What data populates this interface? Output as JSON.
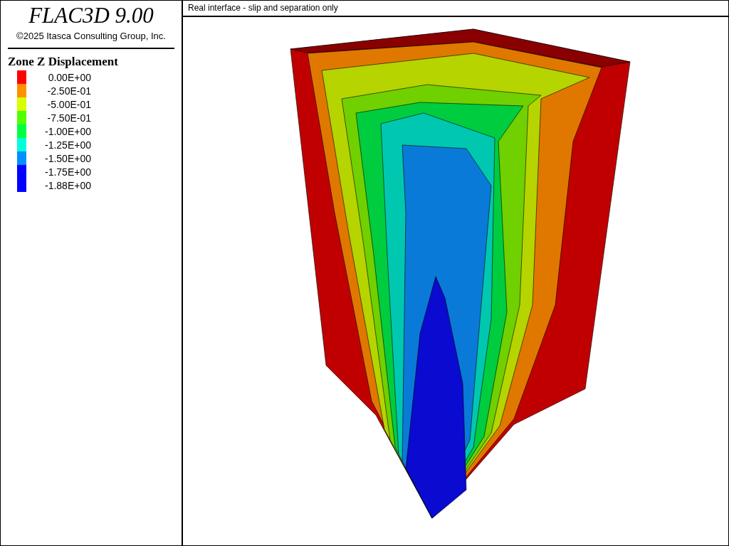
{
  "header": {
    "title": "FLAC3D 9.00",
    "copyright": "©2025 Itasca Consulting Group, Inc."
  },
  "legend": {
    "title": "Zone Z Displacement",
    "items": [
      {
        "value": "0.00E+00",
        "color": "#ff0000"
      },
      {
        "value": "-2.50E-01",
        "color": "#ff9000"
      },
      {
        "value": "-5.00E-01",
        "color": "#d9ff00"
      },
      {
        "value": "-7.50E-01",
        "color": "#50ff00"
      },
      {
        "value": "-1.00E+00",
        "color": "#00ff40"
      },
      {
        "value": "-1.25E+00",
        "color": "#00ffd9"
      },
      {
        "value": "-1.50E+00",
        "color": "#0090ff"
      },
      {
        "value": "-1.75E+00",
        "color": "#0000ff"
      },
      {
        "value": "-1.88E+00",
        "color": "#0000ff"
      }
    ]
  },
  "plot": {
    "title": "Real interface - slip and separation only"
  }
}
